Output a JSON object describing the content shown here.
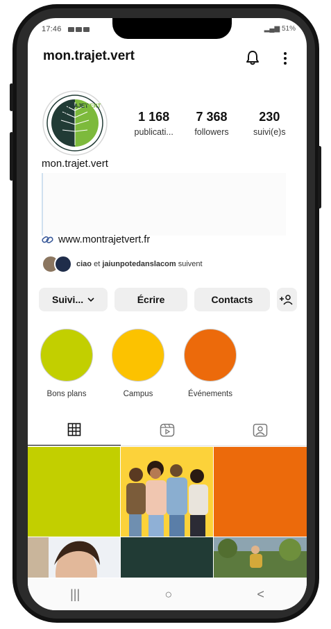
{
  "status": {
    "time": "17:46",
    "battery": "51%"
  },
  "header": {
    "username": "mon.trajet.vert"
  },
  "avatar": {
    "logo_text_1": "MON",
    "logo_text_2": "TRAJET",
    "logo_text_3": "VERT"
  },
  "stats": [
    {
      "value": "1 168",
      "label": "publicati..."
    },
    {
      "value": "7 368",
      "label": "followers"
    },
    {
      "value": "230",
      "label": "suivi(e)s"
    }
  ],
  "profile": {
    "display_name": "mon.trajet.vert",
    "website": "www.montrajetvert.fr",
    "followed_by_1": "ciao",
    "followed_by_connector": " et ",
    "followed_by_2": "jaiunpotedanslacom",
    "followed_by_suffix": " suivent"
  },
  "actions": {
    "following": "Suivi...",
    "message": "Écrire",
    "contacts": "Contacts"
  },
  "highlights": [
    {
      "label": "Bons plans",
      "color": "#c2cf00"
    },
    {
      "label": "Campus",
      "color": "#fcc200"
    },
    {
      "label": "Événements",
      "color": "#ec6a0b"
    }
  ],
  "colors": {
    "lime": "#c2cf00",
    "orange": "#ec6a0b",
    "yellow": "#fcd23a",
    "dark_green": "#213b35"
  },
  "nav": {
    "recent": "|||",
    "home": "○",
    "back": "<"
  }
}
